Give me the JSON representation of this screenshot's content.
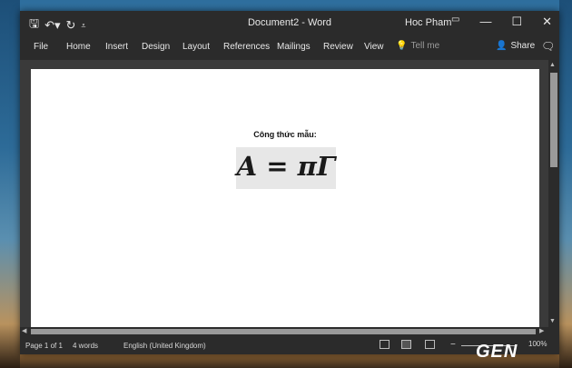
{
  "window": {
    "title": "Document2 - Word",
    "user": "Hoc Pham",
    "qat": {
      "save_icon": "save-icon",
      "undo_icon": "undo-icon",
      "redo_icon": "redo-icon",
      "customize_icon": "customize-qat-icon"
    },
    "controls": {
      "ribbon_display_icon": "ribbon-display-options-icon",
      "minimize": "—",
      "maximize": "☐",
      "close": "✕"
    }
  },
  "ribbon": {
    "tabs": [
      "File",
      "Home",
      "Insert",
      "Design",
      "Layout",
      "References",
      "Mailings",
      "Review",
      "View"
    ],
    "tell_me": "Tell me",
    "share": "Share",
    "comments_icon": "comments-icon"
  },
  "document": {
    "heading": "Công thức mẫu:",
    "formula": "A = πΓ"
  },
  "status_bar": {
    "page": "Page 1 of 1",
    "words": "4 words",
    "language": "English (United Kingdom)",
    "zoom": "100%"
  },
  "watermark": "GEN"
}
